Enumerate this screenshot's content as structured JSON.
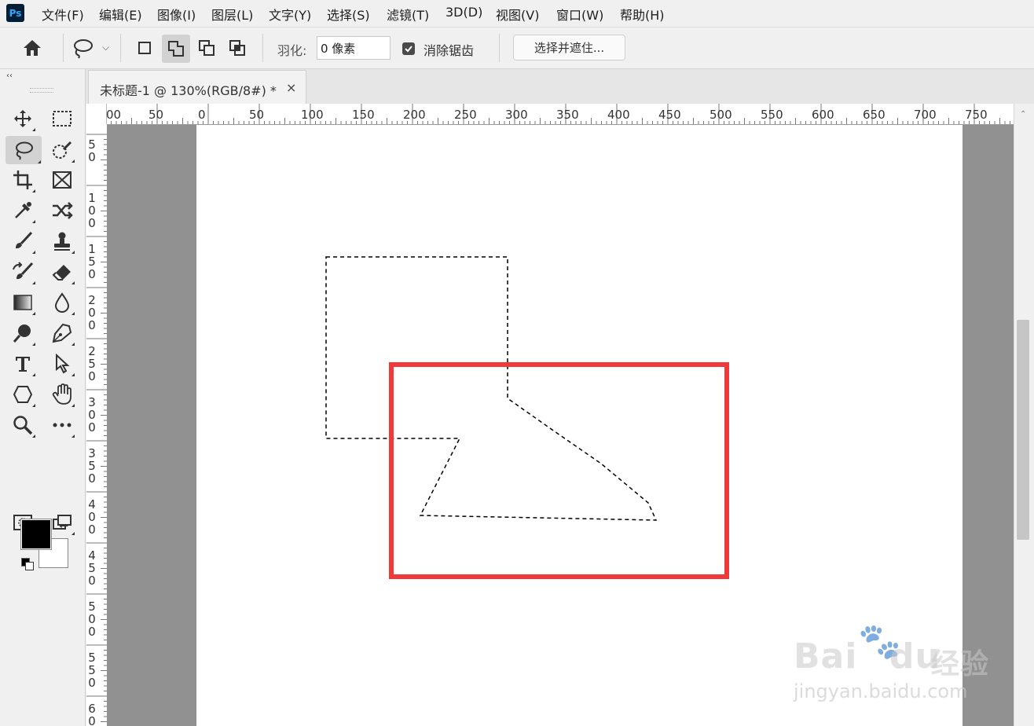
{
  "app": {
    "logo_text": "Ps"
  },
  "menu": [
    "文件(F)",
    "编辑(E)",
    "图像(I)",
    "图层(L)",
    "文字(Y)",
    "选择(S)",
    "滤镜(T)",
    "3D(D)",
    "视图(V)",
    "窗口(W)",
    "帮助(H)"
  ],
  "options": {
    "feather_label": "羽化:",
    "feather_value": "0 像素",
    "antialias_label": "消除锯齿",
    "antialias_checked": true,
    "select_mask_label": "选择并遮住...",
    "selection_modes": [
      "new-selection",
      "add-to-selection",
      "subtract-from-selection",
      "intersect-with-selection"
    ],
    "active_mode": "add-to-selection"
  },
  "toolbox": {
    "collapse_label": "‹‹",
    "active_tool": "lasso-tool",
    "foreground_color": "#000000",
    "background_color": "#ffffff"
  },
  "document": {
    "tab_title": "未标题-1 @ 130%(RGB/8#) *",
    "close_label": "×"
  },
  "ruler": {
    "h_labels": [
      "00",
      "50",
      "0",
      "50",
      "100",
      "150",
      "200",
      "250",
      "300",
      "350",
      "400",
      "450",
      "500",
      "550",
      "600",
      "650",
      "700",
      "750"
    ],
    "v_labels": [
      "50",
      "100",
      "150",
      "200",
      "250",
      "300",
      "350",
      "400",
      "450",
      "500",
      "550",
      "60"
    ]
  },
  "annotation": {
    "color": "#f03a3a"
  },
  "watermark": {
    "brand": "Bai",
    "brand2": "du",
    "suffix": "经验",
    "url": "jingyan.baidu.com"
  }
}
